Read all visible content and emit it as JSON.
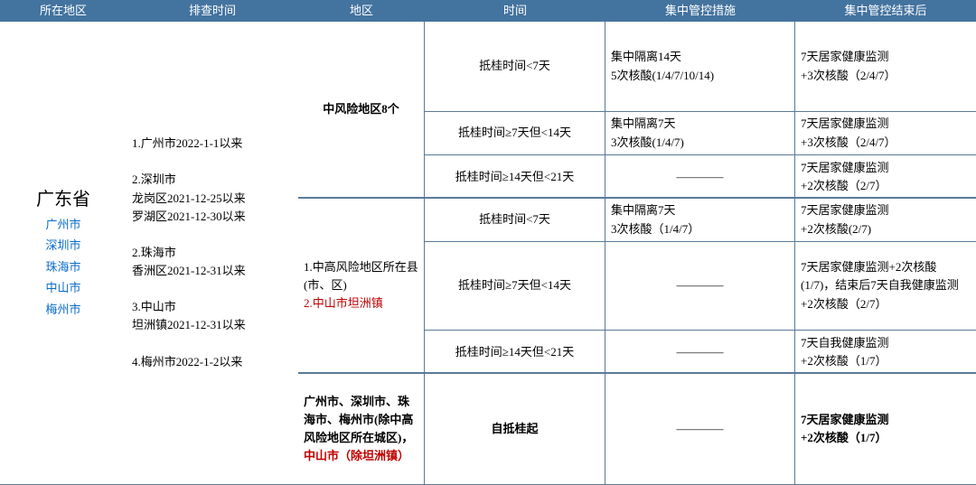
{
  "header": {
    "region": "所在地区",
    "checkTime": "排查时间",
    "area": "地区",
    "duration": "时间",
    "measure": "集中管控措施",
    "after": "集中管控结束后"
  },
  "province": {
    "name": "广东省",
    "cities": [
      "广州市",
      "深圳市",
      "珠海市",
      "中山市",
      "梅州市"
    ]
  },
  "checkTimes": [
    "1.广州市2022-1-1以来",
    "2.深圳市",
    "龙岗区2021-12-25以来",
    "罗湖区2021-12-30以来",
    "",
    "2.珠海市",
    "香洲区2021-12-31以来",
    "",
    "3.中山市",
    "坦洲镇2021-12-31以来",
    "",
    "4.梅州市2022-1-2以来"
  ],
  "areaBlocks": {
    "midRisk": "中风险地区8个",
    "countyLine1": "1.中高风险地区所在县(市、区)",
    "countyLine2": "2.中山市坦洲镇",
    "otherCities1": "广州市、深圳市、珠海市、梅州市(除中高风险地区所在城区)，",
    "otherCities2": "中山市（除坦洲镇）"
  },
  "rows": {
    "r1": {
      "dur": "抵桂时间<7天",
      "measure1": "集中隔离14天",
      "measure2": "5次核酸(1/4/7/10/14)",
      "after1": "7天居家健康监测",
      "after2": "+3次核酸（2/4/7）"
    },
    "r2": {
      "dur": "抵桂时间≥7天但<14天",
      "measure1": "集中隔离7天",
      "measure2": "3次核酸(1/4/7)",
      "after1": "7天居家健康监测",
      "after2": "+3次核酸（2/4/7）"
    },
    "r3": {
      "dur": "抵桂时间≥14天但<21天",
      "measure": "————",
      "after1": "7天居家健康监测",
      "after2": "+2次核酸（2/7）"
    },
    "r4": {
      "dur": "抵桂时间<7天",
      "measure1": "集中隔离7天",
      "measure2": "3次核酸（1/4/7）",
      "after1": "7天居家健康监测",
      "after2": "+2次核酸(2/7)"
    },
    "r5": {
      "dur": "抵桂时间≥7天但<14天",
      "measure": "————",
      "after": "7天居家健康监测+2次核酸(1/7)，结束后7天自我健康监测+2次核酸（2/7）"
    },
    "r6": {
      "dur": "抵桂时间≥14天但<21天",
      "measure": "————",
      "after1": "7天自我健康监测",
      "after2": "+2次核酸（1/7）"
    },
    "r7": {
      "dur": "自抵桂起",
      "measure": "————",
      "after1": "7天居家健康监测",
      "after2": "+2次核酸（1/7）"
    }
  }
}
